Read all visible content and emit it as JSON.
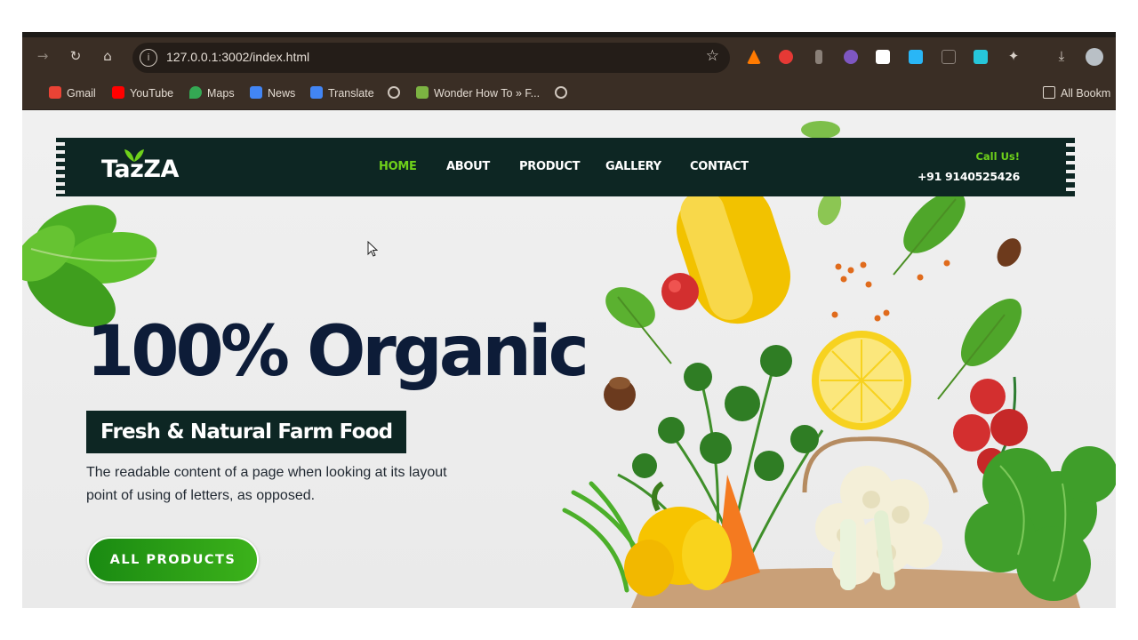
{
  "browser": {
    "url": "127.0.0.1:3002/index.html",
    "bookmarks": [
      {
        "label": "Gmail",
        "color": "#ea4335"
      },
      {
        "label": "YouTube",
        "color": "#ff0000"
      },
      {
        "label": "Maps",
        "color": "#34a853"
      },
      {
        "label": "News",
        "color": "#4285f4"
      },
      {
        "label": "Translate",
        "color": "#4285f4"
      },
      {
        "label": "Wonder How To » F...",
        "color": "#7cb342"
      }
    ],
    "all_bookmarks": "All Bookm"
  },
  "site": {
    "logo": "TazZA",
    "nav": [
      "HOME",
      "ABOUT",
      "PRODUCT",
      "GALLERY",
      "CONTACT"
    ],
    "active_nav": "HOME",
    "call_label": "Call Us!",
    "phone": "+91 9140525426",
    "hero": {
      "title": "100% Organic",
      "subtitle": "Fresh & Natural Farm Food",
      "description": "The readable content of a page when looking at its layout point of using of letters, as opposed.",
      "cta": "ALL PRODUCTS"
    },
    "colors": {
      "dark_green": "#0d2623",
      "accent_green": "#6fd11a",
      "navy": "#0d1c38"
    }
  }
}
